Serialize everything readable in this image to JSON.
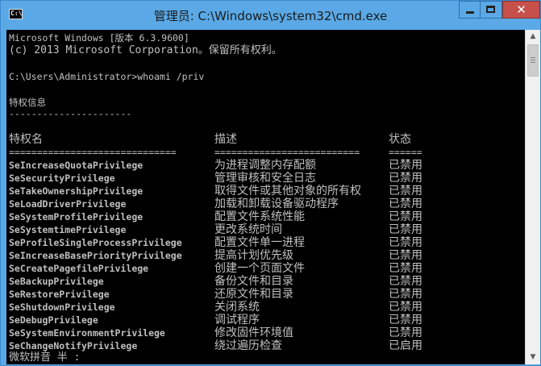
{
  "window": {
    "title": "管理员: C:\\Windows\\system32\\cmd.exe",
    "icon_label": "C:\\",
    "close_glyph": "✕",
    "accent_color": "#5aa9e6",
    "close_color": "#c7504b"
  },
  "console": {
    "banner_line1": "Microsoft Windows [版本 6.3.9600]",
    "banner_line2": "(c) 2013 Microsoft Corporation。保留所有权利。",
    "prompt": "C:\\Users\\Administrator>whoami /priv",
    "section_heading": "特权信息",
    "section_underline": "----------------------",
    "headers": {
      "name": "特权名",
      "desc": "描述",
      "state": "状态"
    },
    "separators": {
      "name": "==============================",
      "desc": "==========================",
      "state": "======"
    },
    "rows": [
      {
        "name": "SeIncreaseQuotaPrivilege",
        "desc": "为进程调整内存配额",
        "state": "已禁用"
      },
      {
        "name": "SeSecurityPrivilege",
        "desc": "管理审核和安全日志",
        "state": "已禁用"
      },
      {
        "name": "SeTakeOwnershipPrivilege",
        "desc": "取得文件或其他对象的所有权",
        "state": "已禁用"
      },
      {
        "name": "SeLoadDriverPrivilege",
        "desc": "加载和卸载设备驱动程序",
        "state": "已禁用"
      },
      {
        "name": "SeSystemProfilePrivilege",
        "desc": "配置文件系统性能",
        "state": "已禁用"
      },
      {
        "name": "SeSystemtimePrivilege",
        "desc": "更改系统时间",
        "state": "已禁用"
      },
      {
        "name": "SeProfileSingleProcessPrivilege",
        "desc": "配置文件单一进程",
        "state": "已禁用"
      },
      {
        "name": "SeIncreaseBasePriorityPrivilege",
        "desc": "提高计划优先级",
        "state": "已禁用"
      },
      {
        "name": "SeCreatePagefilePrivilege",
        "desc": "创建一个页面文件",
        "state": "已禁用"
      },
      {
        "name": "SeBackupPrivilege",
        "desc": "备份文件和目录",
        "state": "已禁用"
      },
      {
        "name": "SeRestorePrivilege",
        "desc": "还原文件和目录",
        "state": "已禁用"
      },
      {
        "name": "SeShutdownPrivilege",
        "desc": "关闭系统",
        "state": "已禁用"
      },
      {
        "name": "SeDebugPrivilege",
        "desc": "调试程序",
        "state": "已禁用"
      },
      {
        "name": "SeSystemEnvironmentPrivilege",
        "desc": "修改固件环境值",
        "state": "已禁用"
      },
      {
        "name": "SeChangeNotifyPrivilege",
        "desc": "绕过遍历检查",
        "state": "已启用"
      }
    ],
    "ime_status": "微软拼音 半 :",
    "text_color": "#c0c0c0",
    "background_color": "#000000"
  },
  "scrollbar": {
    "up_glyph": "▲",
    "down_glyph": "▼"
  }
}
